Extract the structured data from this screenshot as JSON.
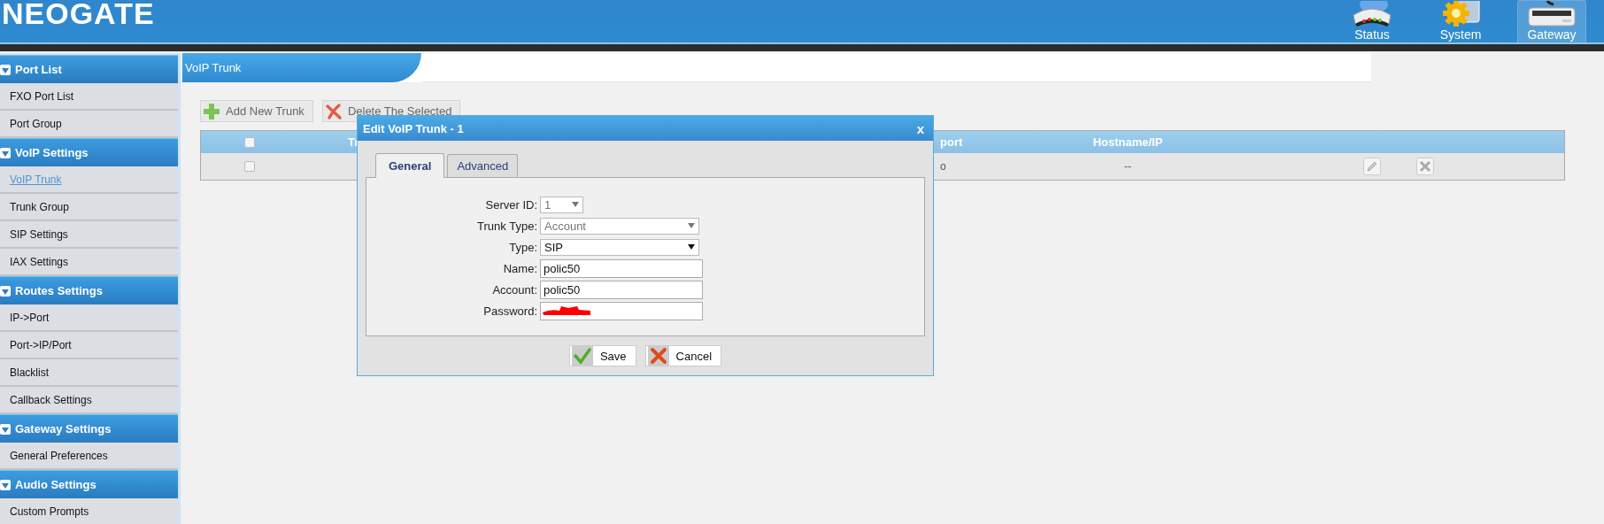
{
  "header": {
    "logo": "NEOGATE",
    "nav": [
      {
        "label": "Status",
        "kind": "status",
        "selected": false
      },
      {
        "label": "System",
        "kind": "system",
        "selected": false
      },
      {
        "label": "Gateway",
        "kind": "gateway",
        "selected": true
      }
    ]
  },
  "sidebar": {
    "sections": [
      {
        "title": "Port List",
        "expanded": true,
        "items": [
          {
            "label": "FXO Port List",
            "selected": false
          },
          {
            "label": "Port Group",
            "selected": false
          }
        ]
      },
      {
        "title": "VoIP Settings",
        "expanded": true,
        "items": [
          {
            "label": "VoIP Trunk",
            "selected": true
          },
          {
            "label": "Trunk Group",
            "selected": false
          },
          {
            "label": "SIP Settings",
            "selected": false
          },
          {
            "label": "IAX Settings",
            "selected": false
          }
        ]
      },
      {
        "title": "Routes Settings",
        "expanded": true,
        "items": [
          {
            "label": "IP->Port",
            "selected": false
          },
          {
            "label": "Port->IP/Port",
            "selected": false
          },
          {
            "label": "Blacklist",
            "selected": false
          },
          {
            "label": "Callback Settings",
            "selected": false
          }
        ]
      },
      {
        "title": "Gateway Settings",
        "expanded": true,
        "items": [
          {
            "label": "General Preferences",
            "selected": false
          }
        ]
      },
      {
        "title": "Audio Settings",
        "expanded": true,
        "items": [
          {
            "label": "Custom Prompts",
            "selected": false
          }
        ]
      }
    ]
  },
  "panel": {
    "title": "VoIP Trunk",
    "toolbar": [
      {
        "label": "Add New Trunk",
        "kind": "add"
      },
      {
        "label": "Delete The Selected",
        "kind": "delete"
      }
    ],
    "table": {
      "columns": [
        {
          "kind": "check",
          "checked": false
        },
        {
          "kind": "text",
          "label": "Tr"
        },
        {
          "kind": "text",
          "label": "port"
        },
        {
          "kind": "text",
          "label": "Hostname/IP"
        }
      ],
      "rows": [
        {
          "checked": false,
          "column_3": "o",
          "hostname": "--"
        }
      ]
    }
  },
  "dialog": {
    "title": "Edit VoIP Trunk - 1",
    "close": "x",
    "tabs": [
      {
        "label": "General",
        "selected": true
      },
      {
        "label": "Advanced",
        "selected": false
      }
    ],
    "fields": [
      {
        "label": "Server ID:",
        "kind": "short_select",
        "value": "1",
        "disabled": true
      },
      {
        "label": "Trunk Type:",
        "kind": "select",
        "value": "Account",
        "disabled": true
      },
      {
        "label": "Type:",
        "kind": "select",
        "value": "SIP",
        "disabled": false
      },
      {
        "label": "Name:",
        "kind": "input",
        "value": "polic50"
      },
      {
        "label": "Account:",
        "kind": "input",
        "value": "polic50"
      },
      {
        "label": "Password:",
        "kind": "password",
        "redacted": true
      }
    ],
    "buttons": [
      {
        "label": "Save",
        "kind": "save"
      },
      {
        "label": "Cancel",
        "kind": "cancel"
      }
    ]
  }
}
